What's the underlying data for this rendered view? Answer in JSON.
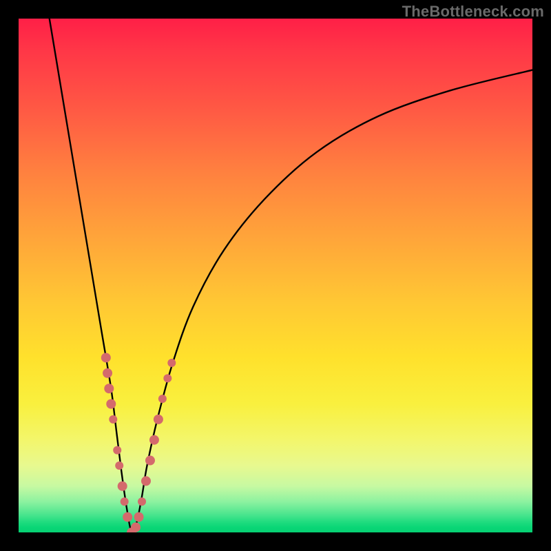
{
  "watermark": "TheBottleneck.com",
  "colors": {
    "frame": "#000000",
    "curve": "#000000",
    "markers": "#d46a6c",
    "gradient_top": "#ff1f47",
    "gradient_mid": "#ffd433",
    "gradient_bottom": "#06d173"
  },
  "chart_data": {
    "type": "line",
    "title": "",
    "xlabel": "",
    "ylabel": "",
    "xlim": [
      0,
      100
    ],
    "ylim": [
      0,
      100
    ],
    "grid": false,
    "legend": false,
    "notes": "Bottleneck-style V curve. X axis implied hardware balance ratio; Y axis implied bottleneck percentage. Background vertical gradient red→yellow→green encodes bottleneck severity (red high, green low). Minimum of curve ≈ x 22, y 0.",
    "series": [
      {
        "name": "bottleneck-curve",
        "x": [
          6,
          8,
          10,
          12,
          14,
          16,
          18,
          19,
          20,
          21,
          22,
          23,
          24,
          25,
          27,
          30,
          34,
          40,
          48,
          58,
          70,
          84,
          100
        ],
        "y": [
          100,
          88,
          76,
          64,
          52,
          40,
          28,
          20,
          12,
          5,
          0,
          2,
          7,
          13,
          22,
          33,
          44,
          55,
          65,
          74,
          81,
          86,
          90
        ]
      }
    ],
    "markers": [
      {
        "x": 17.0,
        "y": 34,
        "size": 7
      },
      {
        "x": 17.3,
        "y": 31,
        "size": 7
      },
      {
        "x": 17.6,
        "y": 28,
        "size": 7
      },
      {
        "x": 18.0,
        "y": 25,
        "size": 7
      },
      {
        "x": 18.4,
        "y": 22,
        "size": 6
      },
      {
        "x": 19.2,
        "y": 16,
        "size": 6
      },
      {
        "x": 19.6,
        "y": 13,
        "size": 6
      },
      {
        "x": 20.2,
        "y": 9,
        "size": 7
      },
      {
        "x": 20.6,
        "y": 6,
        "size": 6
      },
      {
        "x": 21.2,
        "y": 3,
        "size": 7
      },
      {
        "x": 22.0,
        "y": 0,
        "size": 7
      },
      {
        "x": 22.8,
        "y": 1,
        "size": 7
      },
      {
        "x": 23.4,
        "y": 3,
        "size": 7
      },
      {
        "x": 24.0,
        "y": 6,
        "size": 6
      },
      {
        "x": 24.8,
        "y": 10,
        "size": 7
      },
      {
        "x": 25.6,
        "y": 14,
        "size": 7
      },
      {
        "x": 26.4,
        "y": 18,
        "size": 7
      },
      {
        "x": 27.2,
        "y": 22,
        "size": 7
      },
      {
        "x": 28.0,
        "y": 26,
        "size": 6
      },
      {
        "x": 29.0,
        "y": 30,
        "size": 6
      },
      {
        "x": 29.8,
        "y": 33,
        "size": 6
      }
    ]
  }
}
